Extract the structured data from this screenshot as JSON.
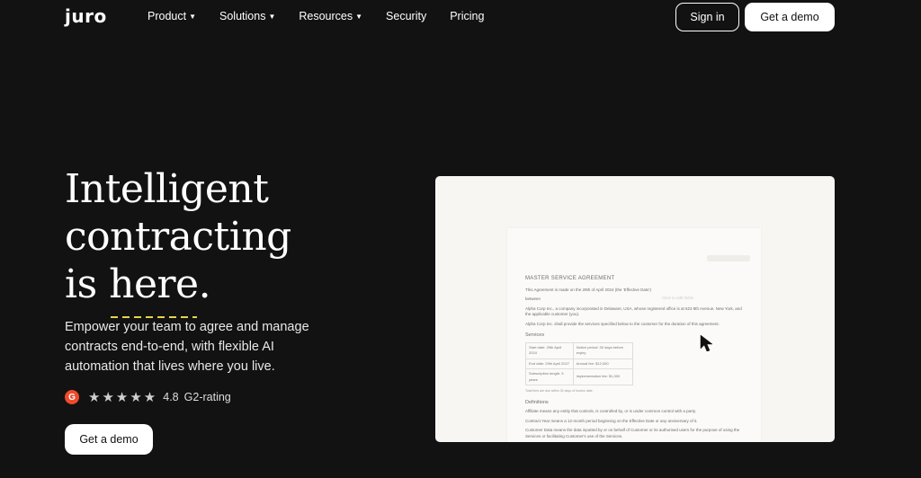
{
  "nav": {
    "logo": "juro",
    "menu": [
      {
        "label": "Product",
        "has_dropdown": true
      },
      {
        "label": "Solutions",
        "has_dropdown": true
      },
      {
        "label": "Resources",
        "has_dropdown": true
      },
      {
        "label": "Security",
        "has_dropdown": false
      },
      {
        "label": "Pricing",
        "has_dropdown": false
      }
    ],
    "sign_in": "Sign in",
    "get_demo": "Get a demo"
  },
  "hero": {
    "title_line1": "Intelligent",
    "title_line2": "contracting",
    "title_line3_pre": "is ",
    "title_line3_underlined": "here",
    "title_line3_post": ".",
    "subtitle": "Empower your team to agree and manage contracts end-to-end, with flexible AI automation that lives where you live.",
    "rating_badge": "G",
    "stars": "★★★★★",
    "rating_value": "4.8",
    "rating_label": "G2-rating",
    "cta": "Get a demo"
  },
  "preview": {
    "doc_title": "MASTER SERVICE AGREEMENT",
    "intro": "This Agreement is made on the 29th of April 2024 (the 'Effective Date')",
    "between": "between",
    "party1": "Alpha Corp Inc., a company incorporated in Delaware, USA, whose registered office is at 623 8th Avenue, New York, and the applicable customer (you).",
    "party2": "Alpha Corp Inc. shall provide the services specified below to the customer for the duration of this agreement.",
    "services_heading": "Services",
    "services_table": [
      [
        "Start date: 29th April 2024",
        "Notice period: 30 days before expiry"
      ],
      [
        "End date: 29th April 2027",
        "Annual fee: $12,000"
      ],
      [
        "Subscription length: 3 years",
        "Implementation fee: $1,000"
      ]
    ],
    "table_note": "Total fees are due within 30 days of invoice date.",
    "definitions_heading": "Definitions",
    "def1": "Affiliate means any entity that controls, is controlled by, or is under common control with a party.",
    "def2": "Contract Year means a 12-month period beginning on the Effective Date or any anniversary of it.",
    "def3": "Customer Data means the data inputted by or on behalf of Customer or its authorised users for the purpose of using the Services or facilitating Customer's use of the Services.",
    "ghost": "Click to edit fields"
  },
  "colors": {
    "background": "#121212",
    "accent_underline": "#e6d44a",
    "g2_red": "#ef4a2d"
  }
}
